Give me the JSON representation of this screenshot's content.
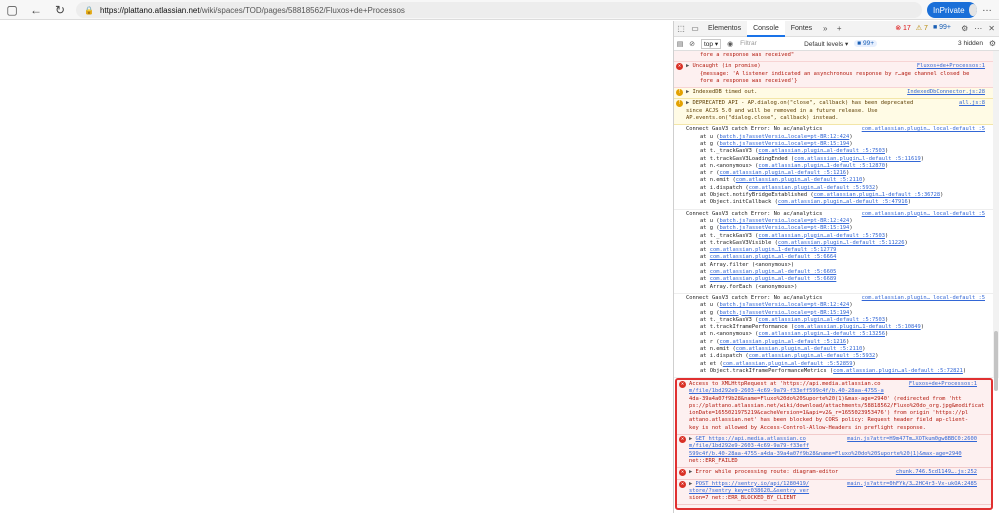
{
  "browser": {
    "url_host": "https://plattano.atlassian.net",
    "url_path": "/wiki/spaces/TOD/pages/58818562/Fluxos+de+Processos",
    "profile_label": "InPrivate"
  },
  "devtools": {
    "tabs": [
      "Elementos",
      "Console",
      "Fontes"
    ],
    "active_tab": "Console",
    "error_count": "17",
    "warning_count": "7",
    "issue_count": "99+",
    "context": "top",
    "filter_placeholder": "Filtrar",
    "levels": "Default levels",
    "issues_badge": "99+",
    "hidden": "3 hidden"
  },
  "console": {
    "top_fragment": "fore a response was received\"",
    "msg_uncaught": {
      "text": "Uncaught (in promise)",
      "src": "Fluxos+de+Processos:1",
      "detail1": "{message: 'A listener indicated an asynchronous response by r…age channel closed be",
      "detail2": "fore a response was received'}"
    },
    "msg_indexeddb": {
      "text": "IndexedDB timed out.",
      "src": "IndexedDbConnector.js:28"
    },
    "msg_deprecated": {
      "line1": "DEPRECATED API - AP.dialog.on(\"close\", callback) has been deprecated",
      "line2": "since ACJS 5.0 and will be removed in a future release. Use",
      "line3": "AP.events.on(\"dialog.close\", callback) instead.",
      "src": "all.js:8"
    },
    "gasv3_1": {
      "head": "Connect GasV3 catch Error: No ac/analytics",
      "src": "com.atlassian.plugin…_local-default_:5",
      "frames": [
        [
          "at u (",
          "batch.js?assetVersio…locale=pt-BR:12:424",
          ")"
        ],
        [
          "at g (",
          "batch.js?assetVersio…locale=pt-BR:15:194",
          ")"
        ],
        [
          "at t._trackGasV3 (",
          "com.atlassian.plugin…al-default_:5:7503",
          ")"
        ],
        [
          "at t.trackGasV3LoadingEnded (",
          "com.atlassian.plugin…l-default_:5:11619",
          ")"
        ],
        [
          "at n.<anonymous> (",
          "com.atlassian.plugin…1-default_:5:12870",
          ")"
        ],
        [
          "at r (",
          "com.atlassian.plugin…al-default_:5:1216",
          ")"
        ],
        [
          "at n.emit (",
          "com.atlassian.plugin…al-default_:5:2110",
          ")"
        ],
        [
          "at i.dispatch (",
          "com.atlassian.plugin…al-default_:5:5932",
          ")"
        ],
        [
          "at Object.notifyBridgeEstablished (",
          "com.atlassian.plugin…1-default_:5:36728",
          ")"
        ],
        [
          "at Object.initCallback (",
          "com.atlassian.plugin…al-default_:5:47916",
          ")"
        ]
      ]
    },
    "gasv3_2": {
      "head": "Connect GasV3 catch Error: No ac/analytics",
      "src": "com.atlassian.plugin…_local-default_:5",
      "frames": [
        [
          "at u (",
          "batch.js?assetVersio…locale=pt-BR:12:424",
          ")"
        ],
        [
          "at g (",
          "batch.js?assetVersio…locale=pt-BR:15:194",
          ")"
        ],
        [
          "at t._trackGasV3 (",
          "com.atlassian.plugin…al-default_:5:7503",
          ")"
        ],
        [
          "at t.trackGasV3Visible (",
          "com.atlassian.plugin…l-default_:5:11226",
          ")"
        ],
        [
          "at ",
          "com.atlassian.plugin…1-default_:5:12779",
          ""
        ],
        [
          "at ",
          "com.atlassian.plugin…al-default_:5:6664",
          ""
        ],
        [
          "at Array.filter (<anonymous>)",
          "",
          ""
        ],
        [
          "at ",
          "com.atlassian.plugin…al-default_:5:6605",
          ""
        ],
        [
          "at ",
          "com.atlassian.plugin…al-default_:5:6689",
          ""
        ],
        [
          "at Array.forEach (<anonymous>)",
          "",
          ""
        ]
      ]
    },
    "gasv3_3": {
      "head": "Connect GasV3 catch Error: No ac/analytics",
      "src": "com.atlassian.plugin…_local-default_:5",
      "frames": [
        [
          "at u (",
          "batch.js?assetVersio…locale=pt-BR:12:424",
          ")"
        ],
        [
          "at g (",
          "batch.js?assetVersio…locale=pt-BR:15:194",
          ")"
        ],
        [
          "at t._trackGasV3 (",
          "com.atlassian.plugin…al-default_:5:7503",
          ")"
        ],
        [
          "at t.trackIframePerformance (",
          "com.atlassian.plugin…1-default_:5:10849",
          ")"
        ],
        [
          "at n.<anonymous> (",
          "com.atlassian.plugin…1-default_:5:13256",
          ")"
        ],
        [
          "at r (",
          "com.atlassian.plugin…al-default_:5:1216",
          ")"
        ],
        [
          "at n.emit (",
          "com.atlassian.plugin…al-default_:5:2110",
          ")"
        ],
        [
          "at i.dispatch (",
          "com.atlassian.plugin…al-default_:5:5932",
          ")"
        ],
        [
          "at et (",
          "com.atlassian.plugin…al-default_:5:52859",
          ")"
        ],
        [
          "at Object.trackIframePerformanceMetrics (",
          "com.atlassian.plugin…al-default_:5:72821",
          ")"
        ]
      ]
    },
    "cors": {
      "src": "Fluxos+de+Processos:1",
      "lines": [
        "Access to XMLHttpRequest at 'https://api.media.atlassian.co",
        "m/file/1bd292e9-2603-4c69-9a79-f33eff599c4f/b.40-28aa-4755-a",
        "4da-39a4a07f9b28&name=Fluxo%20do%20Suporte%20(1)&max-age=2940' (redirected from 'htt",
        "ps://plattano.atlassian.net/wiki/download/attachments/58818562/Fluxo%20do_org.jpg&modificat",
        "ionDate=1655021975219&cacheVersion=1&api=v2&_r=1655023953476') from origin 'https://pl",
        "attano.atlassian.net' has been blocked by CORS policy: Request header field ap-client-",
        "key is not allowed by Access-Control-Allow-Headers in preflight response."
      ]
    },
    "get_failed": {
      "src": "main.js?attr=H9m47Tm…XOTkum0gw8BBC0:2600",
      "lines": [
        "GET https://api.media.atlassian.co",
        "m/file/1bd292e9-2603-4c69-9a79-f33eff",
        "599c4f/b.40-28aa-4755-a4da-39a4a07f9b28&name=Fluxo%20do%20Suporte%20(1)&max-age=2940",
        "net::ERR_FAILED"
      ]
    },
    "route_error": {
      "text": "Error while processing route: diagram-editor",
      "src": "chunk.746.5cd1149….js:252"
    },
    "post_blocked": {
      "src": "main.js?attr=0hFYk/3…2HC4r3-Vx-ukOA:2485",
      "lines": [
        "POST https://sentry.io/api/1280419/",
        "store/?sentry_key=c038620…&sentry_ver",
        "sion=7 net::ERR_BLOCKED_BY_CLIENT"
      ]
    }
  }
}
